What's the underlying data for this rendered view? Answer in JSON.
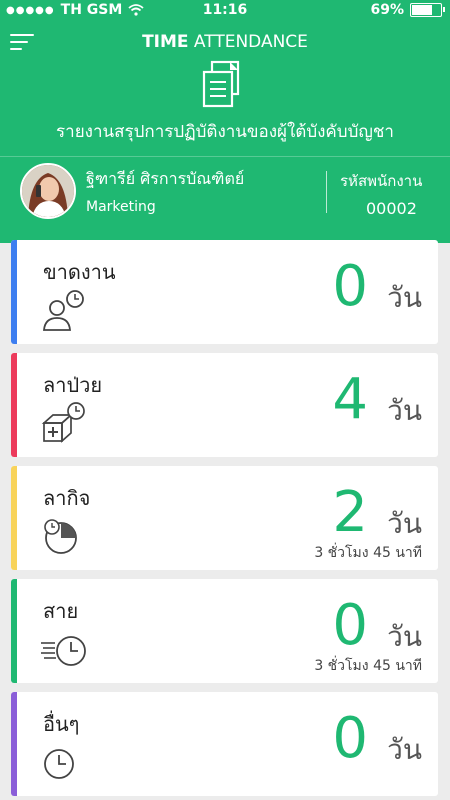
{
  "status_bar": {
    "carrier": "TH GSM",
    "time": "11:16",
    "battery": "69%",
    "signal_dots": "●●●●●"
  },
  "header": {
    "title_bold": "TIME",
    "title_rest": "ATTENDANCE",
    "subtitle": "รายงานสรุปการปฏิบัติงานของผู้ใต้บังคับบัญชา"
  },
  "employee": {
    "name": "ฐิฑารีย์ ศิรการบัณฑิตย์",
    "department": "Marketing",
    "code_label": "รหัสพนักงาน",
    "code": "00002"
  },
  "cards": [
    {
      "label": "ขาดงาน",
      "value": "0",
      "unit": "วัน",
      "sub": "",
      "color": "#3d7ef0",
      "icon": "person-clock-icon"
    },
    {
      "label": "ลาป่วย",
      "value": "4",
      "unit": "วัน",
      "sub": "",
      "color": "#ec3a5b",
      "icon": "medical-box-clock-icon"
    },
    {
      "label": "ลากิจ",
      "value": "2",
      "unit": "วัน",
      "sub": "3 ชั่วโมง 45 นาที",
      "color": "#f8d35a",
      "icon": "clock-quarter-icon"
    },
    {
      "label": "สาย",
      "value": "0",
      "unit": "วัน",
      "sub": "3 ชั่วโมง 45 นาที",
      "color": "#1fb872",
      "icon": "fast-clock-icon"
    },
    {
      "label": "อื่นๆ",
      "value": "0",
      "unit": "วัน",
      "sub": "",
      "color": "#8a5ed8",
      "icon": "clock-icon"
    }
  ],
  "colors": {
    "primary": "#1fb872",
    "background": "#ececec"
  }
}
